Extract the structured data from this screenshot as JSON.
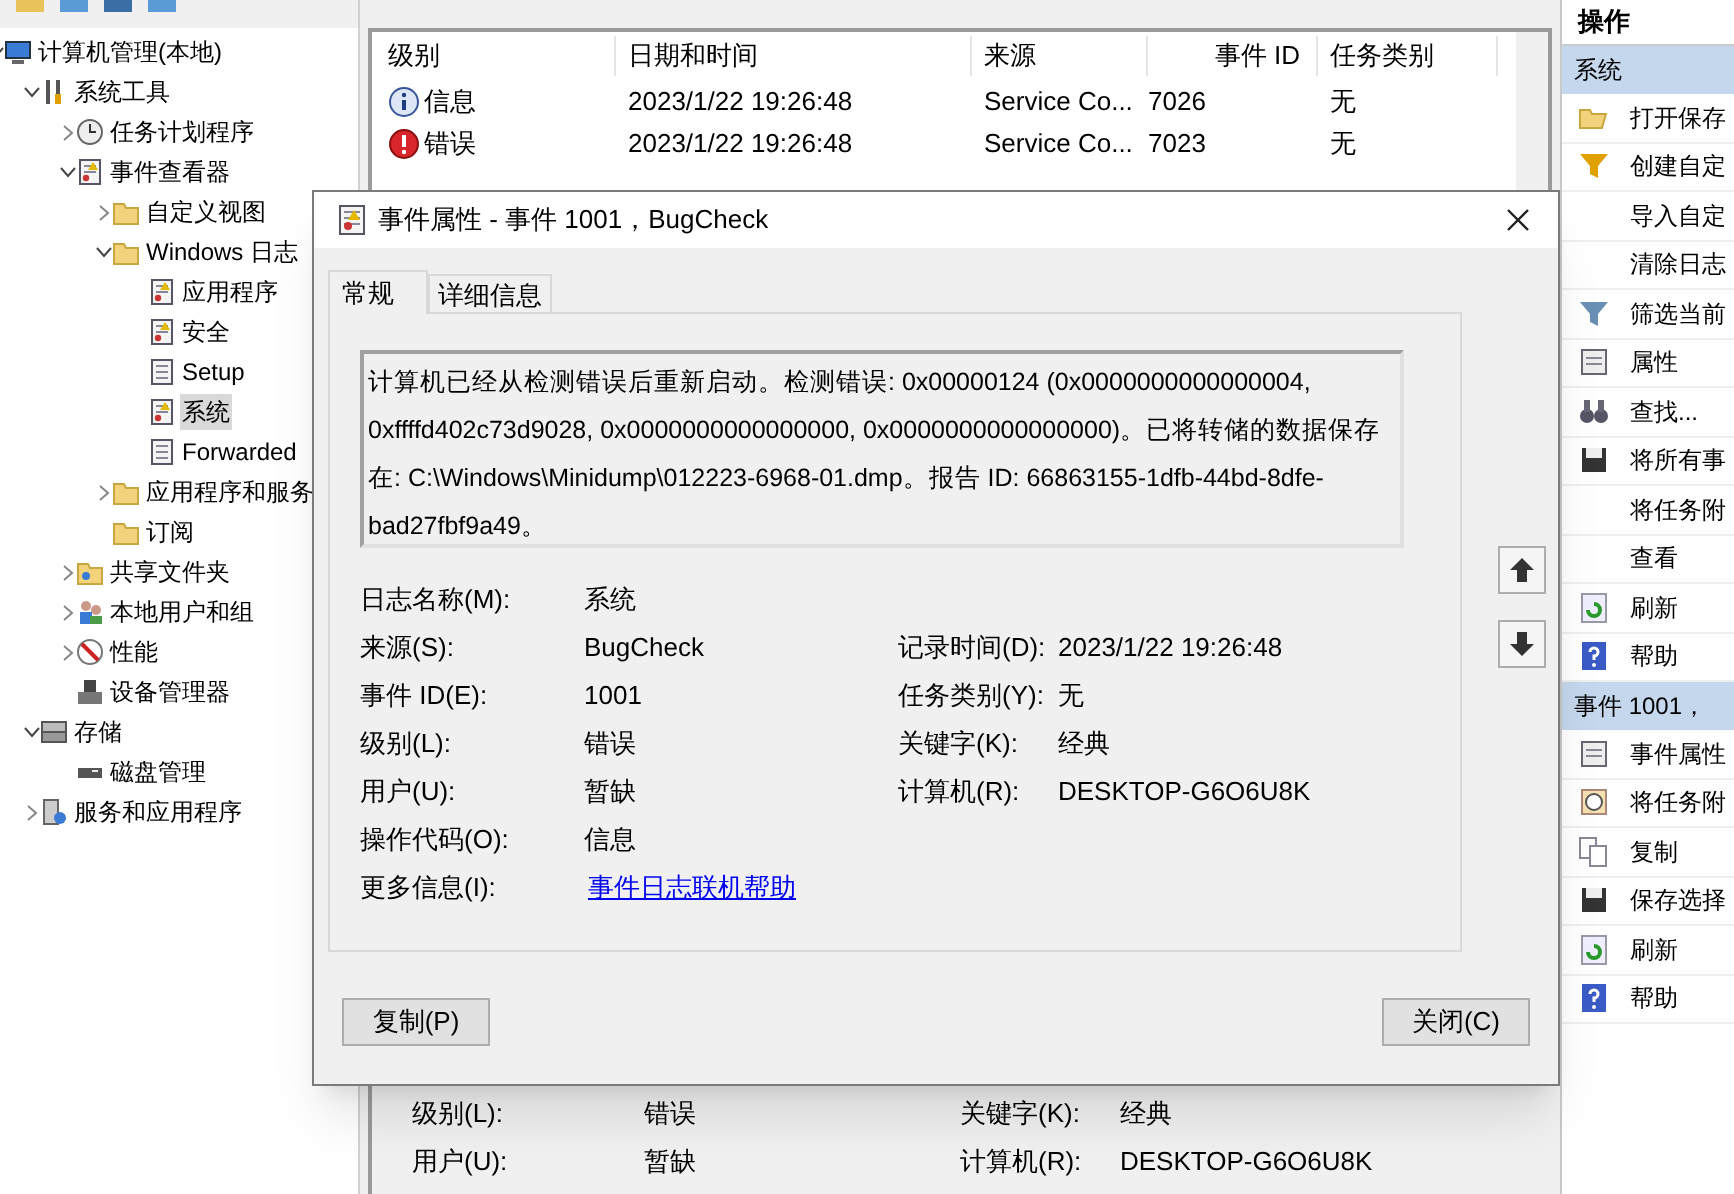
{
  "tree": [
    {
      "label": "计算机管理(本地)",
      "expanded": true,
      "selected": false,
      "children": [
        {
          "label": "系统工具",
          "expanded": true,
          "selected": false,
          "children": [
            {
              "label": "任务计划程序",
              "expanded": false,
              "selected": false
            },
            {
              "label": "事件查看器",
              "expanded": true,
              "selected": false,
              "children": [
                {
                  "label": "自定义视图",
                  "expanded": false,
                  "selected": false
                },
                {
                  "label": "Windows 日志",
                  "expanded": true,
                  "selected": false,
                  "children": [
                    {
                      "label": "应用程序",
                      "selected": false
                    },
                    {
                      "label": "安全",
                      "selected": false
                    },
                    {
                      "label": "Setup",
                      "selected": false
                    },
                    {
                      "label": "系统",
                      "selected": true
                    },
                    {
                      "label": "Forwarded",
                      "selected": false
                    }
                  ]
                },
                {
                  "label": "应用程序和服务",
                  "expanded": false,
                  "selected": false
                },
                {
                  "label": "订阅",
                  "selected": false
                }
              ]
            },
            {
              "label": "共享文件夹",
              "expanded": false,
              "selected": false
            },
            {
              "label": "本地用户和组",
              "expanded": false,
              "selected": false
            },
            {
              "label": "性能",
              "expanded": false,
              "selected": false
            },
            {
              "label": "设备管理器",
              "selected": false
            }
          ]
        },
        {
          "label": "存储",
          "expanded": true,
          "selected": false,
          "children": [
            {
              "label": "磁盘管理",
              "selected": false
            }
          ]
        },
        {
          "label": "服务和应用程序",
          "expanded": false,
          "selected": false
        }
      ]
    }
  ],
  "table": {
    "columns": [
      "级别",
      "日期和时间",
      "来源",
      "事件 ID",
      "任务类别"
    ],
    "rows": [
      {
        "kind": "info",
        "cells": [
          "信息",
          "2023/1/22 19:26:48",
          "Service Co...",
          "7026",
          "无"
        ]
      },
      {
        "kind": "error",
        "cells": [
          "错误",
          "2023/1/22 19:26:48",
          "Service Co...",
          "7023",
          "无"
        ]
      }
    ]
  },
  "preview": [
    {
      "label": "级别(L):",
      "value": "错误",
      "label_2": "关键字(K):",
      "value_2": "经典"
    },
    {
      "label": "用户(U):",
      "value": "暂缺",
      "label_2": "计算机(R):",
      "value_2": "DESKTOP-G6O6U8K"
    }
  ],
  "actions": {
    "title": "操作",
    "sections": [
      {
        "title": "系统",
        "items": [
          "打开保存",
          "创建自定",
          "导入自定",
          "清除日志",
          "筛选当前",
          "属性",
          "查找...",
          "将所有事",
          "将任务附",
          "查看",
          "刷新",
          "帮助"
        ]
      },
      {
        "title": "事件 1001，",
        "items": [
          "事件属性",
          "将任务附",
          "复制",
          "保存选择",
          "刷新",
          "帮助"
        ]
      }
    ]
  },
  "dialog": {
    "title": "事件属性 - 事件 1001，BugCheck",
    "tabs": [
      {
        "label": "常规",
        "selected": true
      },
      {
        "label": "详细信息",
        "selected": false
      }
    ],
    "description": "计算机已经从检测错误后重新启动。检测错误: 0x00000124 (0x0000000000000004, 0xffffd402c73d9028, 0x0000000000000000, 0x0000000000000000)。已将转储的数据保存在: C:\\Windows\\Minidump\\012223-6968-01.dmp。报告 ID: 66863155-1dfb-44bd-8dfe-bad27fbf9a49。",
    "fields": [
      {
        "label": "日志名称(M):",
        "value": "系统"
      },
      {
        "label": "来源(S):",
        "value": "BugCheck",
        "label_2": "记录时间(D):",
        "value_2": "2023/1/22 19:26:48"
      },
      {
        "label": "事件 ID(E):",
        "value": "1001",
        "label_2": "任务类别(Y):",
        "value_2": "无"
      },
      {
        "label": "级别(L):",
        "value": "错误",
        "label_2": "关键字(K):",
        "value_2": "经典"
      },
      {
        "label": "用户(U):",
        "value": "暂缺",
        "label_2": "计算机(R):",
        "value_2": "DESKTOP-G6O6U8K"
      },
      {
        "label": "操作代码(O):",
        "value": "信息"
      },
      {
        "label": "更多信息(I):",
        "value": "事件日志联机帮助",
        "kind": "link"
      }
    ],
    "buttons": [
      "复制(P)",
      "关闭(C)"
    ]
  }
}
